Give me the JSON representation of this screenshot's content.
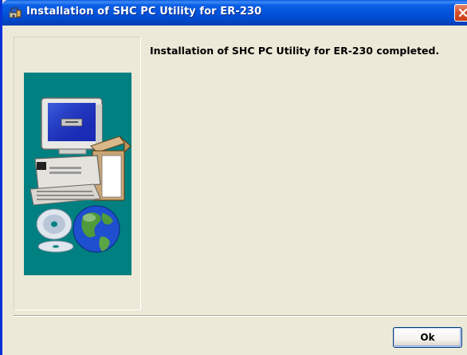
{
  "window": {
    "title": "Installation of SHC PC Utility for ER-230",
    "title_icon": "installer-icon",
    "close_icon": "close-icon"
  },
  "content": {
    "message": "Installation of SHC PC Utility for ER-230 completed.",
    "illustration": "computer-with-cd-and-globe-illustration"
  },
  "buttons": {
    "ok_label": "Ok"
  },
  "colors": {
    "titlebar": "#0352d8",
    "dialog_background": "#ece9d8",
    "illustration_background": "#008080",
    "close_button": "#d9542b"
  }
}
